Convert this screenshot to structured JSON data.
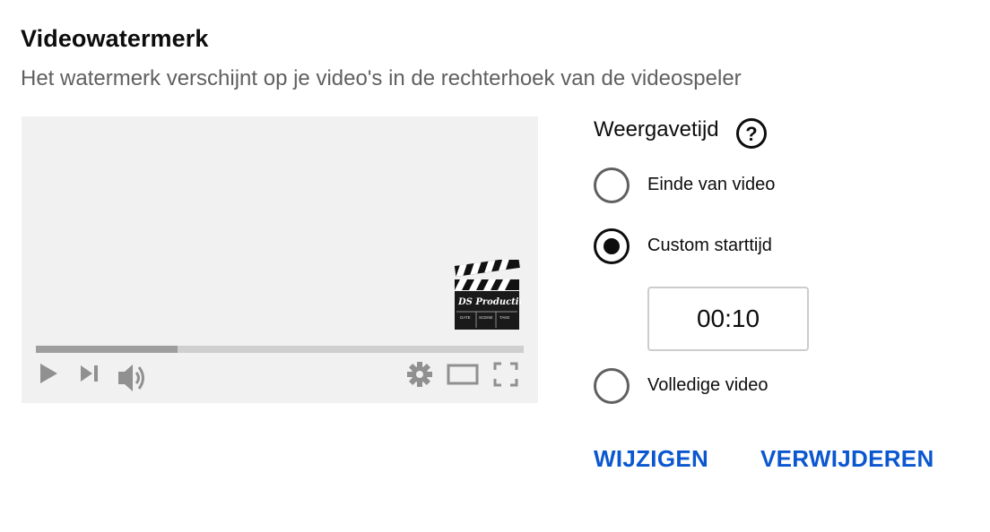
{
  "header": {
    "title": "Videowatermerk",
    "subtitle": "Het watermerk verschijnt op je video's in de rechterhoek van de videospeler"
  },
  "player": {
    "progress_fraction": 0.29,
    "watermark": {
      "label": "DS Productie",
      "slate_fields": [
        "DATE",
        "SCENE",
        "TAKE"
      ]
    },
    "controls": {
      "left": [
        "play-icon",
        "skip-next-icon",
        "volume-icon"
      ],
      "right": [
        "gear-icon",
        "theater-mode-icon",
        "fullscreen-icon"
      ]
    }
  },
  "display_time": {
    "heading": "Weergavetijd",
    "help_icon": "help-icon",
    "options": [
      {
        "label": "Einde van video",
        "checked": false
      },
      {
        "label": "Custom starttijd",
        "checked": true
      },
      {
        "label": "Volledige video",
        "checked": false
      }
    ],
    "start_time_value": "00:10"
  },
  "actions": {
    "change_label": "WIJZIGEN",
    "remove_label": "VERWIJDEREN"
  },
  "colors": {
    "accent": "#0b57d0",
    "player_bg": "#f1f1f1",
    "control_icon": "#909090"
  }
}
